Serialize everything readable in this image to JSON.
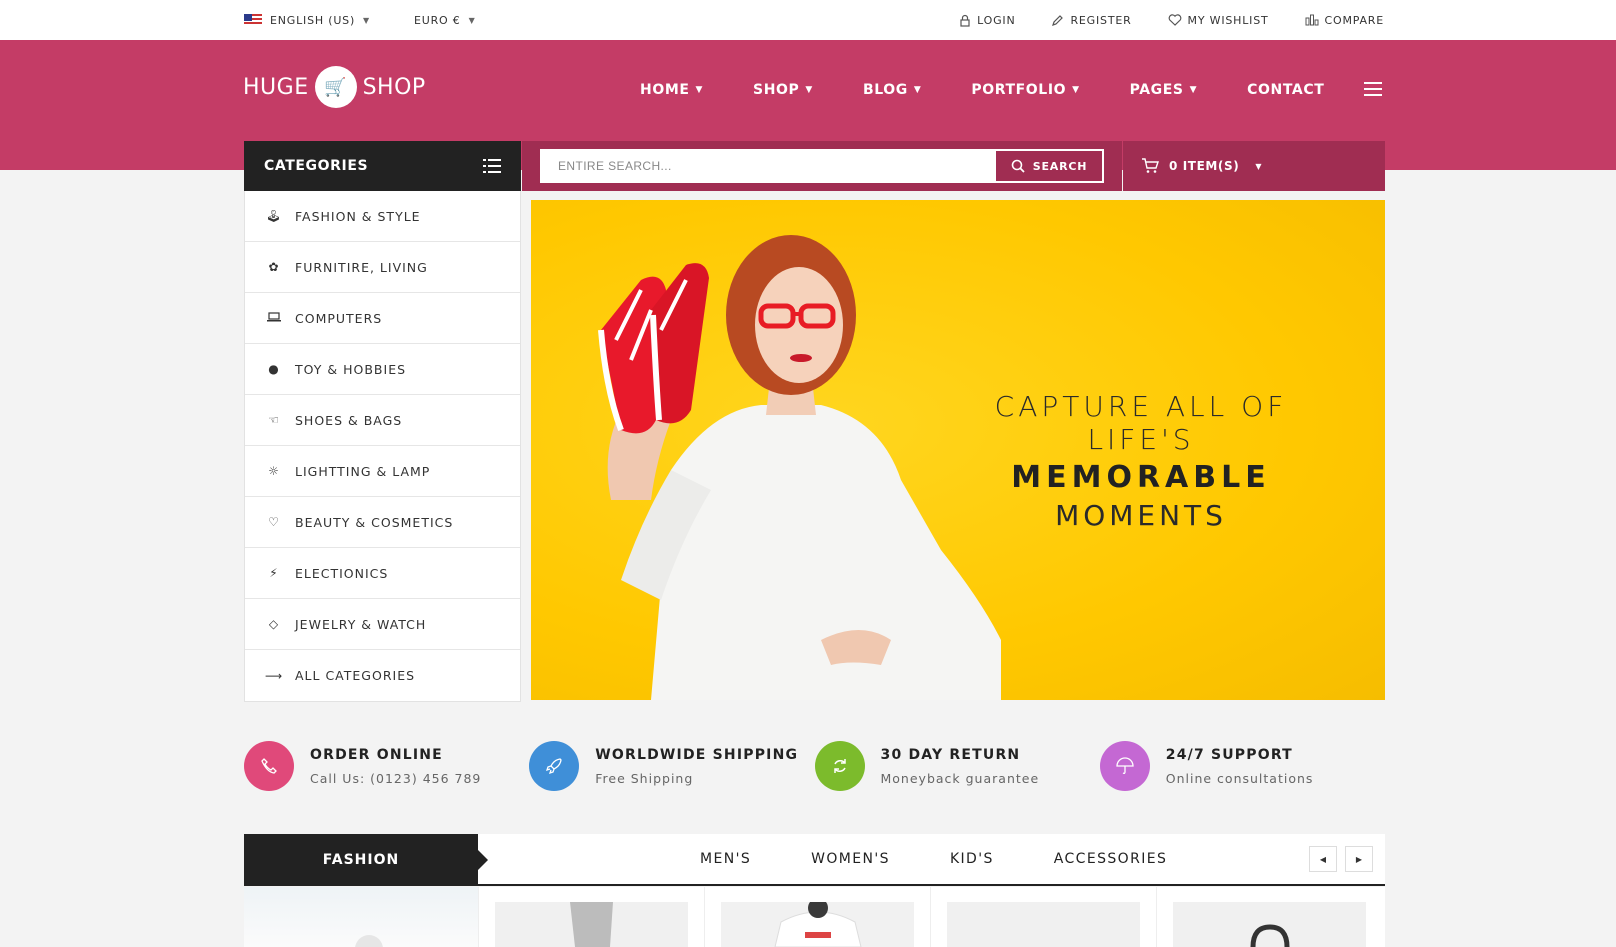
{
  "topbar": {
    "language": "ENGLISH (US)",
    "currency": "EURO €",
    "login": "LOGIN",
    "register": "REGISTER",
    "wishlist": "MY WISHLIST",
    "compare": "COMPARE"
  },
  "header": {
    "logo_left": "HUGE",
    "logo_right": "SHOP",
    "nav": {
      "home": "HOME",
      "shop": "SHOP",
      "blog": "BLOG",
      "portfolio": "PORTFOLIO",
      "pages": "PAGES",
      "contact": "CONTACT"
    }
  },
  "categories": {
    "title": "CATEGORIES",
    "items": [
      {
        "label": "FASHION & STYLE",
        "icon": "person-icon"
      },
      {
        "label": "FURNITIRE, LIVING",
        "icon": "plant-icon"
      },
      {
        "label": "COMPUTERS",
        "icon": "laptop-icon"
      },
      {
        "label": "TOY & HOBBIES",
        "icon": "paw-icon"
      },
      {
        "label": "SHOES & BAGS",
        "icon": "thumbs-up-icon"
      },
      {
        "label": "LIGHTTING & LAMP",
        "icon": "sun-icon"
      },
      {
        "label": "BEAUTY & COSMETICS",
        "icon": "heart-icon"
      },
      {
        "label": "ELECTIONICS",
        "icon": "lightning-icon"
      },
      {
        "label": "JEWELRY & WATCH",
        "icon": "diamond-icon"
      },
      {
        "label": "ALL CATEGORIES",
        "icon": "arrow-right-icon"
      }
    ]
  },
  "search": {
    "placeholder": "ENTIRE SEARCH...",
    "button": "SEARCH"
  },
  "cart": {
    "label": "0 ITEM(S)"
  },
  "banner": {
    "line1": "CAPTURE ALL OF LIFE'S",
    "line2": "MEMORABLE",
    "line3": "MOMENTS"
  },
  "features": [
    {
      "title": "ORDER ONLINE",
      "subtitle": "Call Us: (0123) 456 789",
      "icon": "phone-icon",
      "color": "#e0497a"
    },
    {
      "title": "WORLDWIDE SHIPPING",
      "subtitle": "Free Shipping",
      "icon": "rocket-icon",
      "color": "#3f8fd8"
    },
    {
      "title": "30 DAY RETURN",
      "subtitle": "Moneyback guarantee",
      "icon": "refresh-icon",
      "color": "#7cbb2c"
    },
    {
      "title": "24/7 SUPPORT",
      "subtitle": "Online consultations",
      "icon": "umbrella-icon",
      "color": "#c468d3"
    }
  ],
  "tabs": {
    "active": "FASHION",
    "links": [
      "MEN'S",
      "WOMEN'S",
      "KID'S",
      "ACCESSORIES"
    ]
  },
  "colors": {
    "brand": "#c43c66",
    "brand_dark": "#a02d52",
    "banner_bg": "#ffc800",
    "dark": "#222222"
  }
}
